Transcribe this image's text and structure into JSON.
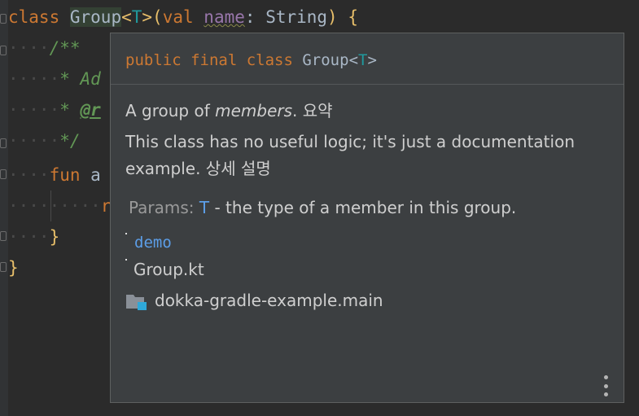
{
  "editor": {
    "line1": {
      "kw_class": "class",
      "type_name": "Group",
      "lt": "<",
      "type_param": "T",
      "gt_paren": ">(",
      "kw_val": "val",
      "prop_name": "name",
      "colon": ":",
      "param_type": "String",
      "close": ")",
      "brace": "{"
    },
    "line2": {
      "indent": "····",
      "doc": "/**"
    },
    "line3": {
      "indent": "·····",
      "doc": "* Ad"
    },
    "line4": {
      "indent": "·····",
      "star": "* ",
      "tag": "@r"
    },
    "line5": {
      "indent": "·····",
      "doc": "*/"
    },
    "line6": {
      "indent": "····",
      "kw_fun": "fun",
      "rest": "a"
    },
    "line7": {
      "indent": "·········",
      "rest": "r"
    },
    "line8": {
      "indent": "····",
      "brace": "}"
    },
    "line9": {
      "brace": "}"
    }
  },
  "popup": {
    "signature": {
      "kw": "public final class",
      "name": "Group",
      "lt": "<",
      "type_param": "T",
      "gt": ">"
    },
    "summary": {
      "lead": "A group of ",
      "emphasis": "members",
      "tail": ". 요약"
    },
    "description": "This class has no useful logic; it's just a documentation example. 상세 설명",
    "params": {
      "label": "Params:",
      "name": "T",
      "text": "- the type of a member in this group."
    },
    "module_link": "demo",
    "file_name": "Group.kt",
    "module_name": "dokka-gradle-example.main",
    "icons": {
      "folder": "module-folder-icon",
      "more": "more-options-icon"
    },
    "colors": {
      "accent_blue": "#5c9ee8",
      "keyword": "#cc7832",
      "background": "#3c3f41"
    }
  }
}
